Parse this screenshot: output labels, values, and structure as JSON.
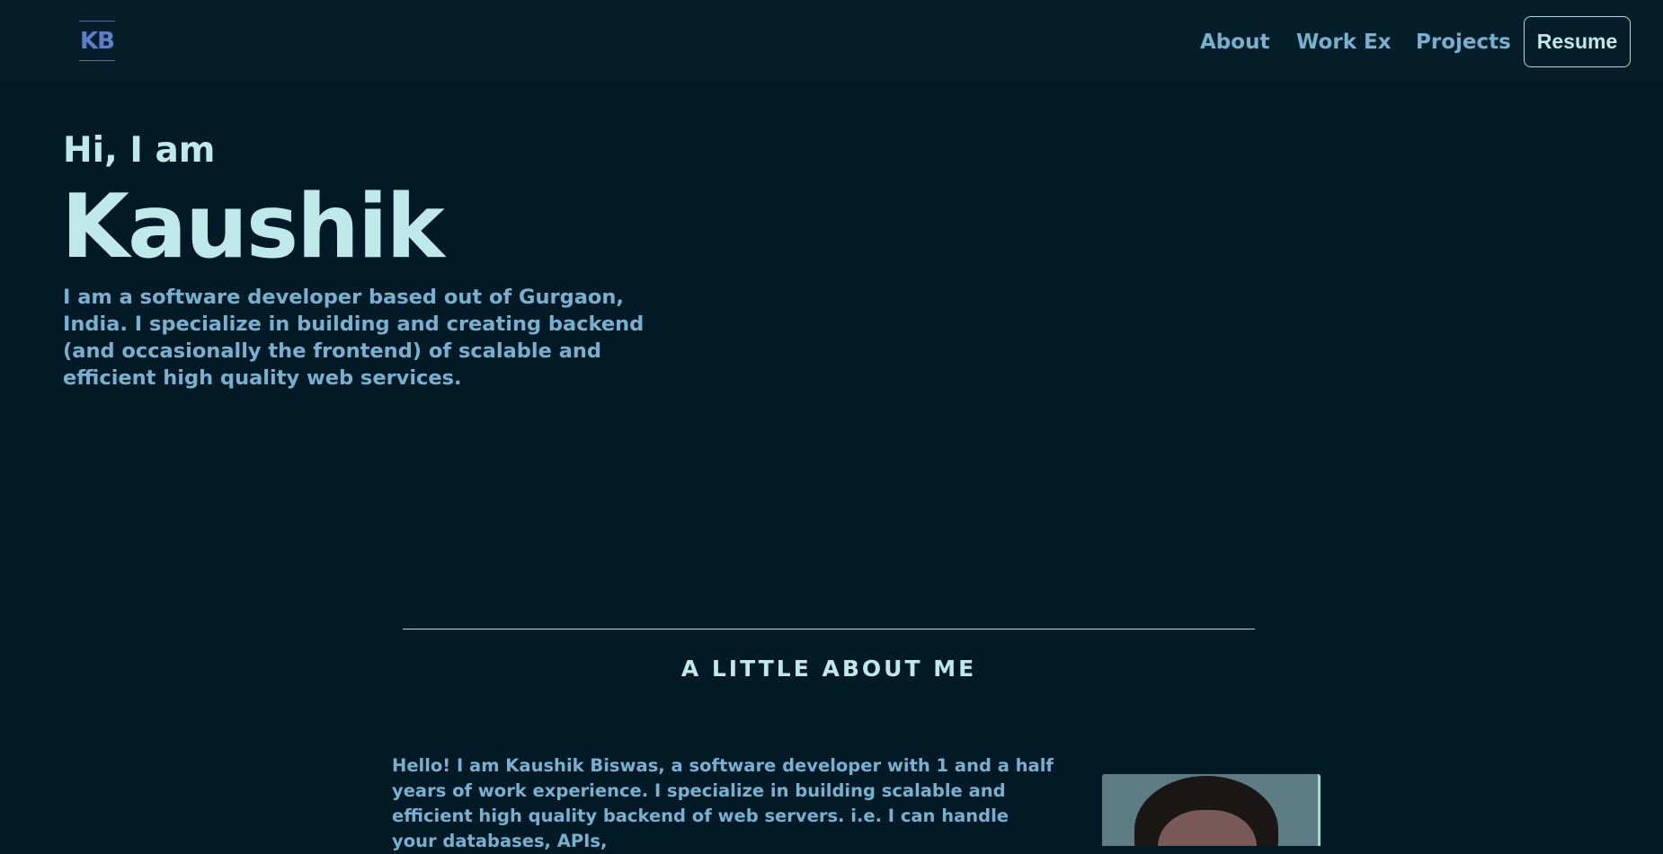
{
  "nav": {
    "logo": "KB",
    "links": [
      "About",
      "Work Ex",
      "Projects"
    ],
    "resume_label": "Resume"
  },
  "hero": {
    "greeting": "Hi, I am",
    "name": "Kaushik",
    "description": "I am a software developer based out of Gurgaon, India. I specialize in building and creating backend (and occasionally the frontend) of scalable and efficient high quality web services."
  },
  "about": {
    "title": "A LITTLE ABOUT ME",
    "text": "Hello! I am Kaushik Biswas, a software developer with 1 and a half years of work experience. I specialize in building scalable and efficient high quality backend of web servers. i.e. I can handle your databases, APIs,"
  },
  "colors": {
    "background": "#021a26",
    "accent": "#bfe8ea",
    "text": "#79b0cf"
  }
}
